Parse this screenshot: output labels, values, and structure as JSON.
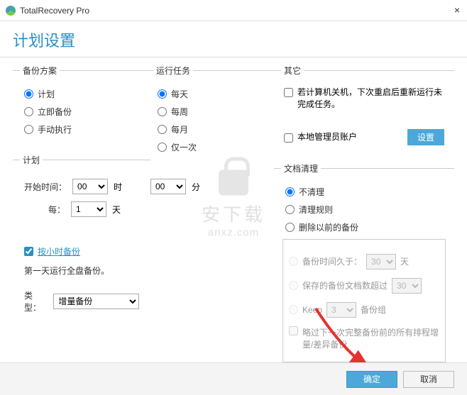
{
  "titlebar": {
    "title": "TotalRecovery Pro",
    "close": "×"
  },
  "page_title": "计划设置",
  "backup_plan": {
    "legend": "备份方案",
    "opts": [
      "计划",
      "立即备份",
      "手动执行"
    ],
    "selected": 0
  },
  "run_task": {
    "legend": "运行任务",
    "opts": [
      "每天",
      "每周",
      "每月",
      "仅一次"
    ],
    "selected": 0
  },
  "misc": {
    "legend": "其它",
    "restart_label": "若计算机关机，下次重启后重新运行未完成任务。",
    "admin_label": "本地管理员账户",
    "set_btn": "设置"
  },
  "plan": {
    "legend": "计划",
    "start_label": "开始时间：",
    "hour_val": "00",
    "hour_unit": "时",
    "min_val": "00",
    "min_unit": "分",
    "every_label": "每：",
    "every_val": "1",
    "every_unit": "天",
    "hourly_label": "按小时备份",
    "first_day": "第一天运行全盘备份。",
    "type_label": "类型：",
    "type_val": "增量备份"
  },
  "cleanup": {
    "legend": "文档清理",
    "opts": [
      "不清理",
      "清理规则",
      "删除以前的备份"
    ],
    "selected": 0,
    "older_label": "备份时间久于：",
    "older_val": "30",
    "older_unit": "天",
    "count_label": "保存的备份文档数超过",
    "count_val": "30",
    "keep_label": "Keep",
    "keep_val": "3",
    "keep_unit": "备份组",
    "skip_label": "略过下一次完整备份前的所有排程增量/差异备份"
  },
  "footer": {
    "ok": "确定",
    "cancel": "取消"
  },
  "watermark": {
    "cn": "安下载",
    "en": "anxz.com"
  }
}
